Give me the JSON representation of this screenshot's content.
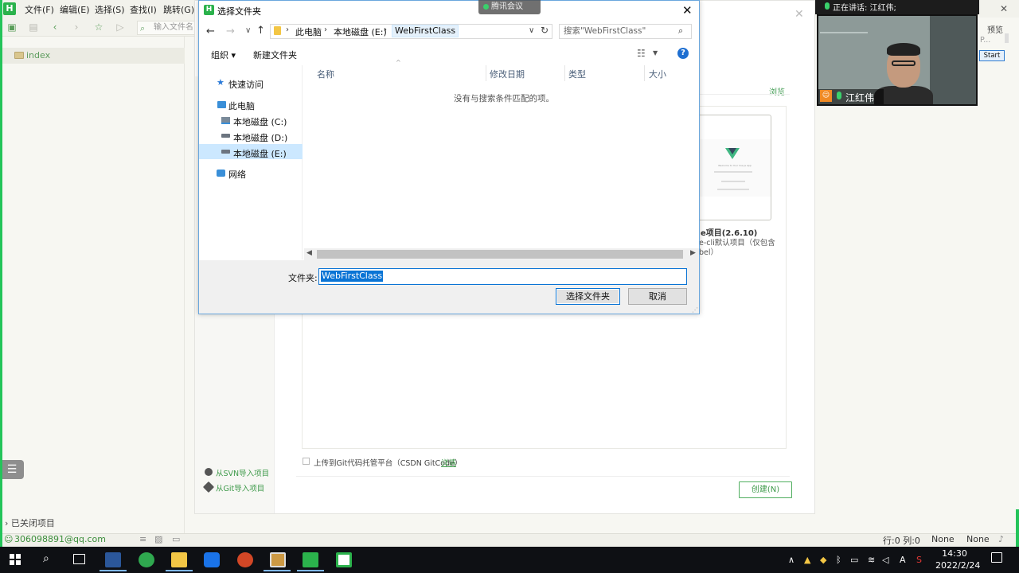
{
  "hbuilder": {
    "menus": [
      "文件(F)",
      "编辑(E)",
      "选择(S)",
      "查找(I)",
      "跳转(G)"
    ],
    "search_placeholder": "输入文件名",
    "project_name": "index",
    "closed_projects_label": "已关闭项目",
    "account": "306098891@qq.com",
    "status": {
      "position": "行:0  列:0",
      "encoding": "None",
      "syntax": "None"
    }
  },
  "new_project": {
    "browse_label": "浏览",
    "vue_title": "e项目(2.6.10)",
    "vue_desc_1": "e-cli默认项目（仅包含",
    "vue_desc_2": "bel）",
    "card_thumb_text": "Welcome to Your Vue.js App",
    "import_svn": "从SVN导入项目",
    "import_git": "从Git导入项目",
    "upload_label": "上传到Git代码托管平台（CSDN GitCode）",
    "detail_link": "详情",
    "create_button": "创建(N)"
  },
  "folder_dialog": {
    "title": "选择文件夹",
    "breadcrumbs": [
      "此电脑",
      "本地磁盘 (E:)",
      "WebFirstClass"
    ],
    "search_placeholder": "搜索\"WebFirstClass\"",
    "organize_label": "组织 ▾",
    "new_folder_label": "新建文件夹",
    "nav": {
      "quick_access": "快速访问",
      "this_pc": "此电脑",
      "drive_c": "本地磁盘 (C:)",
      "drive_d": "本地磁盘 (D:)",
      "drive_e": "本地磁盘 (E:)",
      "network": "网络"
    },
    "columns": [
      "名称",
      "修改日期",
      "类型",
      "大小"
    ],
    "empty_message": "没有与搜索条件匹配的项。",
    "folder_label": "文件夹:",
    "folder_value": "WebFirstClass",
    "select_button": "选择文件夹",
    "cancel_button": "取消"
  },
  "meeting": {
    "app_label": "腾讯会议",
    "speaking_label": "正在讲话: 江红伟;",
    "participant_name": "江红伟"
  },
  "preview_panel": {
    "preview_label": "预览",
    "truncated": "P...",
    "start_button": "Start"
  },
  "taskbar": {
    "time": "14:30",
    "date": "2022/2/24",
    "ime": "A",
    "colors": {
      "word": "#2b579a",
      "ppt": "#d24726",
      "hbuilder": "#2bb24c",
      "explorer": "#f3c645",
      "browser": "#2fa84f",
      "camtasia": "#ffffff"
    }
  }
}
